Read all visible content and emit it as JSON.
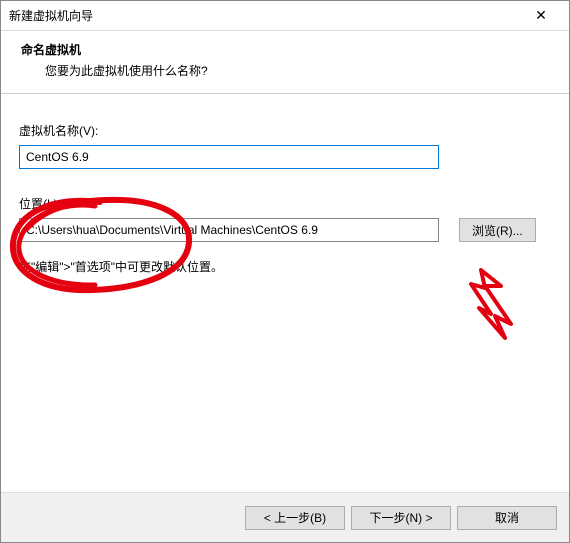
{
  "titlebar": {
    "title": "新建虚拟机向导"
  },
  "header": {
    "title": "命名虚拟机",
    "subtitle": "您要为此虚拟机使用什么名称?"
  },
  "fields": {
    "name_label": "虚拟机名称(V):",
    "name_value": "CentOS 6.9",
    "location_label": "位置(L):",
    "location_value": "C:\\Users\\hua\\Documents\\Virtual Machines\\CentOS 6.9",
    "browse_label": "浏览(R)..."
  },
  "hint": "在\"编辑\">\"首选项\"中可更改默认位置。",
  "footer": {
    "back": "< 上一步(B)",
    "next": "下一步(N) >",
    "cancel": "取消"
  }
}
